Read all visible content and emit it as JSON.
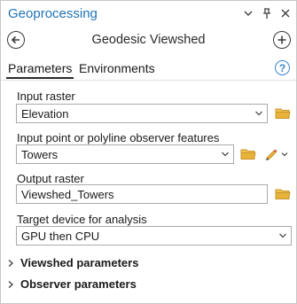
{
  "window": {
    "title": "Geoprocessing"
  },
  "tool": {
    "title": "Geodesic Viewshed"
  },
  "tabs": [
    {
      "label": "Parameters"
    },
    {
      "label": "Environments"
    }
  ],
  "help": {
    "glyph": "?"
  },
  "parameters": {
    "input_raster": {
      "label": "Input raster",
      "value": "Elevation"
    },
    "observer_features": {
      "label": "Input point or polyline observer features",
      "value": "Towers"
    },
    "output_raster": {
      "label": "Output raster",
      "value": "Viewshed_Towers"
    },
    "target_device": {
      "label": "Target device for analysis",
      "value": "GPU then CPU"
    }
  },
  "sections": [
    {
      "label": "Viewshed parameters"
    },
    {
      "label": "Observer parameters"
    }
  ],
  "colors": {
    "accent": "#1f73b7",
    "folder": "#e8b33a",
    "help": "#3a86d1"
  }
}
